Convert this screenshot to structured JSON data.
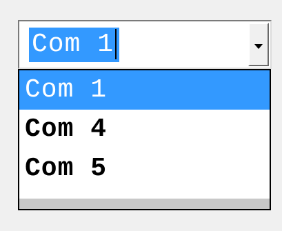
{
  "combo": {
    "selected_text": "Com 1",
    "button_icon": "chevron-down-icon"
  },
  "dropdown": {
    "items": [
      {
        "label": "Com 1",
        "selected": true
      },
      {
        "label": "Com 4",
        "selected": false
      },
      {
        "label": "Com 5",
        "selected": false
      }
    ]
  },
  "colors": {
    "highlight": "#3399ff",
    "window_bg": "#f0f0f0"
  }
}
